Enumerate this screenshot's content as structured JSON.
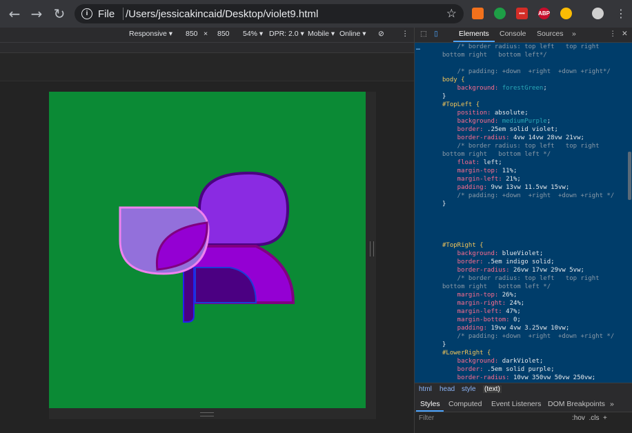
{
  "browser": {
    "scheme": "File",
    "url": "/Users/jessicakincaid/Desktop/violet9.html",
    "extensions": [
      {
        "name": "chart-extension-icon",
        "color": "#f2711c",
        "label": ""
      },
      {
        "name": "evernote-icon",
        "color": "#1e9e46",
        "label": ""
      },
      {
        "name": "lastpass-icon",
        "color": "#d32d27",
        "label": "•••"
      },
      {
        "name": "adblock-plus-icon",
        "color": "#c70d2c",
        "label": "ABP"
      },
      {
        "name": "chrome-extension-icon",
        "color": "#fbbc04",
        "label": ""
      },
      {
        "name": "profile-avatar",
        "color": "#cfcfcf",
        "label": ""
      }
    ]
  },
  "device_toolbar": {
    "device": "Responsive ▾",
    "width": "850",
    "times": "×",
    "height": "850",
    "zoom": "54% ▾",
    "dpr": "DPR: 2.0 ▾",
    "mode": "Mobile ▾",
    "network": "Online ▾"
  },
  "devtools": {
    "tabs": [
      "Elements",
      "Console",
      "Sources",
      "»"
    ],
    "breadcrumbs": [
      "html",
      "head",
      "style",
      "(text)"
    ],
    "styles_tabs": [
      "Styles",
      "Computed",
      "Event Listeners",
      "DOM Breakpoints",
      "»"
    ],
    "filter_placeholder": "Filter",
    "filter_tools": ":hov  .cls  +",
    "code": [
      {
        "t": "comment",
        "text": "    /* border radius: top left   top right"
      },
      {
        "t": "comment",
        "text": "bottom right   bottom left*/"
      },
      {
        "t": "blank",
        "text": ""
      },
      {
        "t": "comment",
        "text": "    /* padding: +down  +right  +down +right*/"
      },
      {
        "t": "sel",
        "text": "body {"
      },
      {
        "t": "decl",
        "prop": "    background:",
        "val": " forestGreen",
        "kw": true
      },
      {
        "t": "brace",
        "text": "}"
      },
      {
        "t": "sel",
        "text": "#TopLeft {"
      },
      {
        "t": "decl",
        "prop": "    position:",
        "val": " absolute;"
      },
      {
        "t": "decl",
        "prop": "    background:",
        "val": " mediumPurple",
        "kw": true
      },
      {
        "t": "decl",
        "prop": "    border:",
        "val": " .25em solid violet;"
      },
      {
        "t": "decl",
        "prop": "    border-radius:",
        "val": " 4vw 14vw 28vw 21vw;"
      },
      {
        "t": "comment",
        "text": "    /* border radius: top left   top right"
      },
      {
        "t": "comment",
        "text": "bottom right   bottom left */"
      },
      {
        "t": "decl",
        "prop": "    float:",
        "val": " left;"
      },
      {
        "t": "decl",
        "prop": "    margin-top:",
        "val": " 11%;"
      },
      {
        "t": "decl",
        "prop": "    margin-left:",
        "val": " 21%;"
      },
      {
        "t": "decl",
        "prop": "    padding:",
        "val": " 9vw 13vw 11.5vw 15vw;"
      },
      {
        "t": "comment",
        "text": "    /* padding: +down  +right  +down +right */"
      },
      {
        "t": "brace",
        "text": "}"
      },
      {
        "t": "blank",
        "text": ""
      },
      {
        "t": "blank",
        "text": ""
      },
      {
        "t": "blank",
        "text": ""
      },
      {
        "t": "blank",
        "text": ""
      },
      {
        "t": "sel",
        "text": "#TopRight {"
      },
      {
        "t": "decl",
        "prop": "    background:",
        "val": " blueViolet;"
      },
      {
        "t": "decl",
        "prop": "    border:",
        "val": " .5em indigo solid;"
      },
      {
        "t": "decl",
        "prop": "    border-radius:",
        "val": " 26vw 17vw 29vw 5vw;"
      },
      {
        "t": "comment",
        "text": "    /* border radius: top left   top right"
      },
      {
        "t": "comment",
        "text": "bottom right   bottom left */"
      },
      {
        "t": "decl",
        "prop": "    margin-top:",
        "val": " 26%;"
      },
      {
        "t": "decl",
        "prop": "    margin-right:",
        "val": " 24%;"
      },
      {
        "t": "decl",
        "prop": "    margin-left:",
        "val": " 47%;"
      },
      {
        "t": "decl",
        "prop": "    margin-bottom:",
        "val": " 0;"
      },
      {
        "t": "decl",
        "prop": "    padding:",
        "val": " 19vw 4vw 3.25vw 10vw;"
      },
      {
        "t": "comment",
        "text": "    /* padding: +down  +right  +down +right */"
      },
      {
        "t": "brace",
        "text": "}"
      },
      {
        "t": "sel",
        "text": "#LowerRight {"
      },
      {
        "t": "decl",
        "prop": "    background:",
        "val": " darkViolet;"
      },
      {
        "t": "decl",
        "prop": "    border:",
        "val": " .5em solid purple;"
      },
      {
        "t": "decl",
        "prop": "    border-radius:",
        "val": " 10vw 350vw 50vw 250vw;"
      }
    ]
  },
  "colors": {
    "page_bg": "#0b8a35",
    "top_right": "#8a2be2",
    "top_left": "#9370db",
    "lower_right": "#9400d3",
    "indigo": "#4b0082",
    "violet": "#ee82ee",
    "purple": "#800080"
  }
}
